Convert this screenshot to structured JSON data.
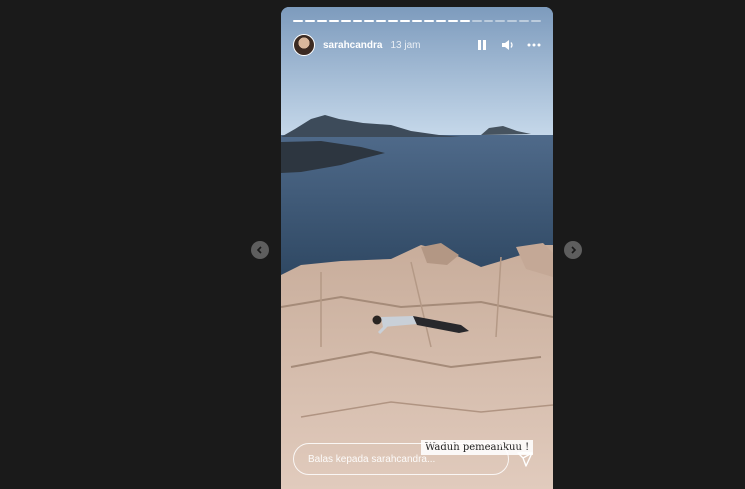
{
  "story": {
    "username": "sarahcandra",
    "time": "13 jam",
    "progress": {
      "segments": 21,
      "current": 15
    },
    "caption": "Waduh pemeankuu !",
    "reply_placeholder": "Balas kepada sarahcandra..."
  },
  "icons": {
    "pause": "pause-icon",
    "sound": "speaker-icon",
    "more": "more-horizontal-icon",
    "send": "send-icon",
    "prev": "chevron-left-icon",
    "next": "chevron-right-icon"
  },
  "colors": {
    "page_background": "#1a1a1a",
    "nav_button": "#5e5e5e",
    "sea": "#3c5572",
    "sky": "#b8cfe6",
    "rock": "#cfb6a4"
  }
}
